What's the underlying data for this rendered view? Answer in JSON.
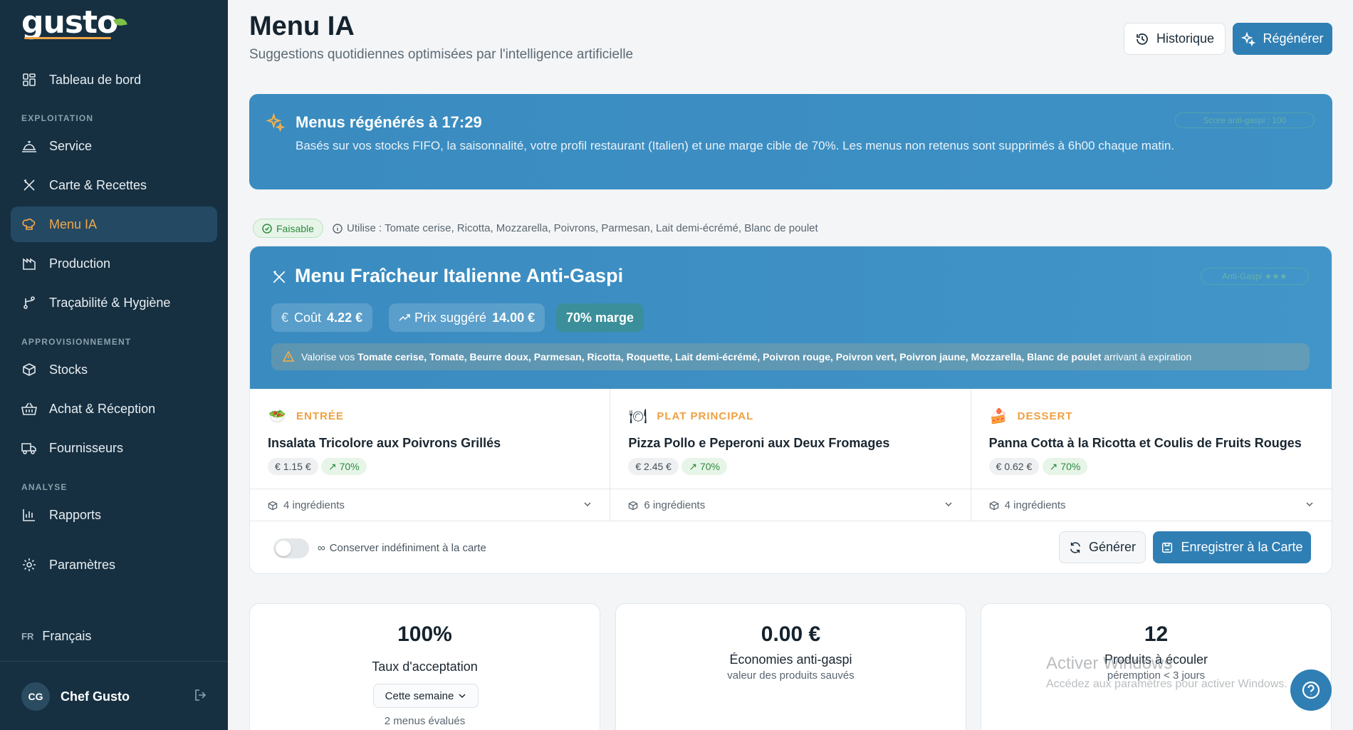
{
  "brand": {
    "name": "gusto"
  },
  "sidebar": {
    "top_item": {
      "label": "Tableau de bord",
      "icon": "dashboard-icon"
    },
    "sections": [
      {
        "title": "EXPLOITATION"
      },
      {
        "title": "APPROVISIONNEMENT"
      },
      {
        "title": "ANALYSE"
      }
    ],
    "items": [
      {
        "label": "Service",
        "icon": "cloche-icon"
      },
      {
        "label": "Carte & Recettes",
        "icon": "utensils-icon"
      },
      {
        "label": "Menu IA",
        "icon": "chef-hat-icon",
        "active": true
      },
      {
        "label": "Production",
        "icon": "factory-icon"
      },
      {
        "label": "Traçabilité & Hygiène",
        "icon": "branch-icon"
      },
      {
        "label": "Stocks",
        "icon": "box-icon"
      },
      {
        "label": "Achat & Réception",
        "icon": "basket-icon"
      },
      {
        "label": "Fournisseurs",
        "icon": "truck-icon"
      },
      {
        "label": "Rapports",
        "icon": "bar-chart-icon"
      },
      {
        "label": "Paramètres",
        "icon": "gear-icon"
      }
    ],
    "language": {
      "code": "FR",
      "label": "Français"
    },
    "user": {
      "initials": "CG",
      "name": "Chef Gusto"
    }
  },
  "header": {
    "title": "Menu IA",
    "subtitle": "Suggestions quotidiennes optimisées par l'intelligence artificielle",
    "history_label": "Historique",
    "regenerate_label": "Régénérer"
  },
  "banner": {
    "title": "Menus régénérés à 17:29",
    "text": "Basés sur vos stocks FIFO, la saisonnalité, votre profil restaurant (Italien) et une marge cible de 70%. Les menus non retenus sont supprimés à 6h00 chaque matin.",
    "badge": "Score anti-gaspi : 100"
  },
  "feasibility": {
    "badge": "Faisable",
    "uses": "Utilise : Tomate cerise, Ricotta, Mozzarella, Poivrons, Parmesan, Lait demi-écrémé, Blanc de poulet"
  },
  "menu": {
    "title": "Menu Fraîcheur Italienne Anti-Gaspi",
    "badge": "Anti-Gaspi ★★★",
    "cost_label": "Coût",
    "cost_value": "4.22 €",
    "price_label": "Prix suggéré",
    "price_value": "14.00 €",
    "margin": "70% marge",
    "warning_prefix": "Valorise vos",
    "warning_items": "Tomate cerise, Tomate, Beurre doux, Parmesan, Ricotta, Roquette, Lait demi-écrémé, Poivron rouge, Poivron vert, Poivron jaune, Mozzarella, Blanc de poulet",
    "warning_suffix": "arrivant à expiration",
    "courses": [
      {
        "type": "ENTRÉE",
        "icon": "salad-icon",
        "name": "Insalata Tricolore aux Poivrons Grillés",
        "cost": "1.15 €",
        "margin": "70%",
        "ingredients": "4 ingrédients"
      },
      {
        "type": "PLAT PRINCIPAL",
        "icon": "plate-icon",
        "name": "Pizza Pollo e Peperoni aux Deux Fromages",
        "cost": "2.45 €",
        "margin": "70%",
        "ingredients": "6 ingrédients"
      },
      {
        "type": "DESSERT",
        "icon": "cake-icon",
        "name": "Panna Cotta à la Ricotta et Coulis de Fruits Rouges",
        "cost": "0.62 €",
        "margin": "70%",
        "ingredients": "4 ingrédients"
      }
    ],
    "keep_label": "Conserver indéfiniment à la carte",
    "keep_enabled": false,
    "generate_label": "Générer",
    "save_label": "Enregistrer à la Carte"
  },
  "stats": [
    {
      "value": "100%",
      "label": "Taux d'acceptation",
      "period": "Cette semaine",
      "note": "2 menus évalués"
    },
    {
      "value": "0.00 €",
      "label": "Économies anti-gaspi",
      "sub": "valeur des produits sauvés"
    },
    {
      "value": "12",
      "label": "Produits à écouler",
      "sub": "péremption < 3 jours"
    }
  ],
  "watermark": {
    "line1": "Activer Windows",
    "line2": "Accédez aux paramètres pour activer Windows."
  },
  "colors": {
    "sidebar": "#163041",
    "accent": "#2f7fb4",
    "active": "#f3a64a",
    "success": "#2e8a3e"
  }
}
